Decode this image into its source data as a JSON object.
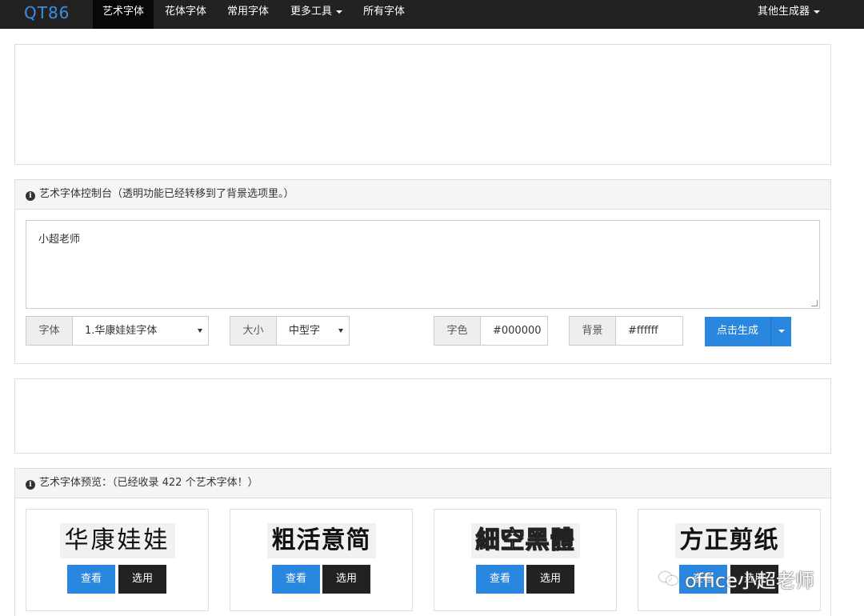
{
  "nav": {
    "brand": "QT86",
    "items": [
      "艺术字体",
      "花体字体",
      "常用字体",
      "更多工具",
      "所有字体"
    ],
    "right": "其他生成器"
  },
  "console": {
    "heading": "艺术字体控制台（透明功能已经转移到了背景选项里。）",
    "text_value": "小超老师",
    "font_label": "字体",
    "font_value": "1.华康娃娃字体",
    "size_label": "大小",
    "size_value": "中型字",
    "color_label": "字色",
    "color_value": "#000000",
    "bg_label": "背景",
    "bg_value": "#ffffff",
    "generate_label": "点击生成"
  },
  "preview": {
    "heading": "艺术字体预览：（已经收录 422 个艺术字体！）",
    "cards": [
      {
        "sample": "华康娃娃",
        "view": "查看",
        "pick": "选用"
      },
      {
        "sample": "粗活意简",
        "view": "查看",
        "pick": "选用"
      },
      {
        "sample": "細空黑體",
        "view": "查看",
        "pick": "选用"
      },
      {
        "sample": "方正剪纸",
        "view": "查看",
        "pick": "选用"
      }
    ]
  },
  "watermark": "office小超老师",
  "colors": {
    "navbar": "#222222",
    "brand": "#3b8fe0",
    "primary": "#2a87e0",
    "dark_button": "#222222"
  }
}
